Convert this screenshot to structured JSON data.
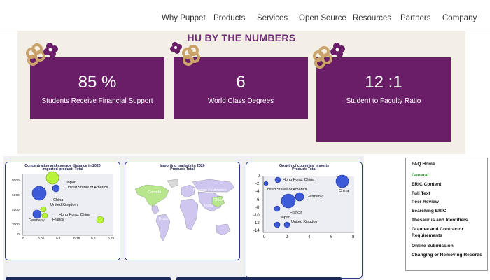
{
  "nav": {
    "items": [
      "Why Puppet",
      "Products",
      "Services",
      "Open Source",
      "Resources",
      "Partners",
      "Company"
    ]
  },
  "hu": {
    "title": "HU BY THE NUMBERS",
    "stats": [
      {
        "value": "85 %",
        "label": "Students Receive Financial Support"
      },
      {
        "value": "6",
        "label": "World Class Degrees"
      },
      {
        "value": "12 :1",
        "label": "Student to Faculty Ratio"
      }
    ]
  },
  "charts": {
    "chart1": {
      "title_line1": "Concentration and average distance in 2020",
      "title_line2": "Imported product: Total",
      "yticks": [
        "8000",
        "6000",
        "4000",
        "2000",
        "0"
      ],
      "xticks": [
        "0",
        "0.05",
        "0.1",
        "0.15",
        "0.2",
        "0.25"
      ],
      "labels": {
        "japan": "Japan",
        "usa": "United States of America",
        "china": "China",
        "uk": "United Kingdom",
        "hk": "Hong Kong, China",
        "germany": "Germany",
        "france": "France"
      }
    },
    "chart2": {
      "title_line1": "Importing markets in 2020",
      "title_line2": "Product: Total",
      "labels": {
        "canada": "Canada",
        "russia": "Russian Federation",
        "china": "China",
        "india": "India",
        "brazil": "Brazil"
      }
    },
    "chart3": {
      "title_line1": "Growth of countries' imports",
      "title_line2": "Product: Total",
      "yticks": [
        "0",
        "-2",
        "-4",
        "-6",
        "-8",
        "-10",
        "-12",
        "-14"
      ],
      "xticks": [
        "0",
        "2",
        "4",
        "6",
        "8"
      ],
      "labels": {
        "hk": "Hong Kong, China",
        "china": "China",
        "usa": "United States of America",
        "germany": "Germany",
        "france": "France",
        "japan": "Japan",
        "uk": "United Kingdom"
      }
    }
  },
  "faq": {
    "items": [
      "FAQ Home",
      "General",
      "ERIC Content",
      "Full Text",
      "Peer Review",
      "Searching ERIC",
      "Thesaurus and Identifiers",
      "Grantee and Contractor Requirements",
      "Online Submission",
      "Changing or Removing Records"
    ],
    "active_color": "#2e8b2e"
  },
  "colors": {
    "card": "#6a1e68",
    "section_bg": "#f4efe6",
    "title": "#6b2b73"
  }
}
